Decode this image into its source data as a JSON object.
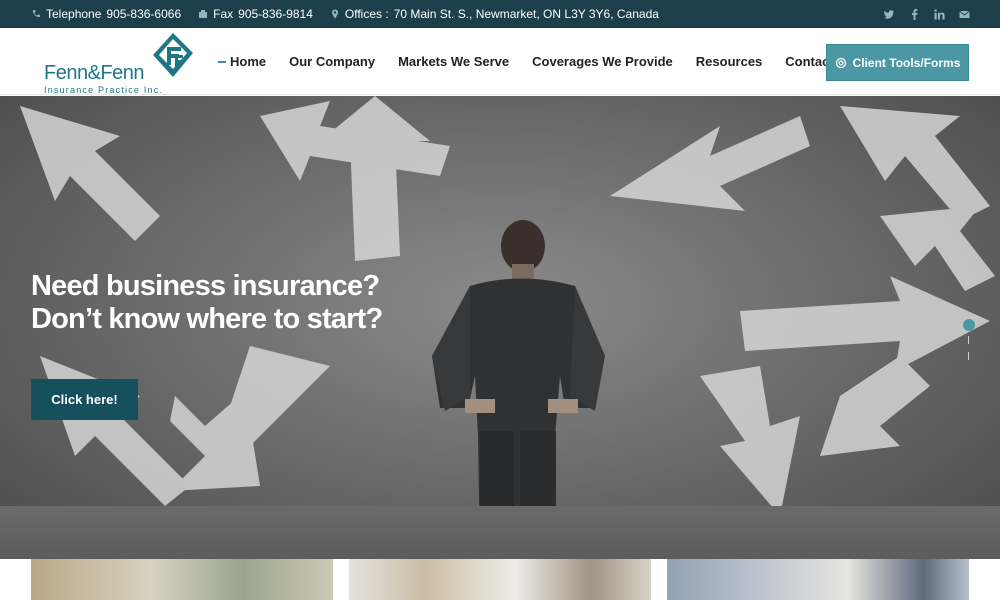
{
  "topbar": {
    "telephone_label": "Telephone",
    "telephone_value": "905-836-6066",
    "fax_label": "Fax",
    "fax_value": "905-836-9814",
    "offices_label": "Offices :",
    "offices_value": "70 Main St. S., Newmarket, ON L3Y 3Y6, Canada",
    "social_icons": [
      "twitter-icon",
      "facebook-icon",
      "linkedin-icon",
      "email-icon"
    ]
  },
  "logo": {
    "name": "Fenn&Fenn",
    "subtitle": "Insurance Practice Inc."
  },
  "nav": {
    "items": [
      "Home",
      "Our Company",
      "Markets We Serve",
      "Coverages We Provide",
      "Resources",
      "Contact Us"
    ],
    "active": "Home"
  },
  "client_tools": {
    "label": "Client Tools/Forms",
    "icon": "gear-icon"
  },
  "hero": {
    "headline": "Need business insurance? Don’t know where to start?",
    "cta_label": "Click here!"
  },
  "colors": {
    "topbar_bg": "#1d3f4b",
    "brand_teal": "#4b97a3",
    "cta_bg": "#16505c",
    "logo_teal": "#1f7785"
  }
}
